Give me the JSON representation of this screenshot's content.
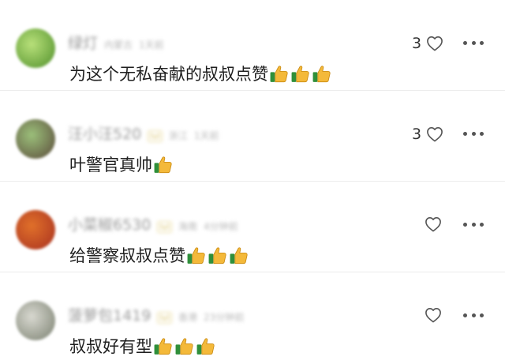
{
  "comments": [
    {
      "name": "绿灯",
      "level": "",
      "region": "内蒙古",
      "time": "1天前",
      "text": "为这个无私奋献的叔叔点赞",
      "thumbs_count": 3,
      "likes": "3",
      "avatar_colors": [
        "#4f8f2a",
        "#b8e07a"
      ]
    },
    {
      "name": "汪小汪520",
      "level": "lvl",
      "region": "浙江",
      "time": "1天前",
      "text": "叶警官真帅",
      "thumbs_count": 1,
      "likes": "3",
      "avatar_colors": [
        "#5a4a3a",
        "#9bbf7a"
      ]
    },
    {
      "name": "小菜椒6530",
      "level": "lvl",
      "region": "海南",
      "time": "4分钟前",
      "text": "给警察叔叔点赞",
      "thumbs_count": 3,
      "likes": "",
      "avatar_colors": [
        "#a83020",
        "#e0702a"
      ]
    },
    {
      "name": "菠萝包1419",
      "level": "lvl",
      "region": "香港",
      "time": "23分钟前",
      "text": "叔叔好有型",
      "thumbs_count": 3,
      "likes": "",
      "avatar_colors": [
        "#7a8070",
        "#d8d8d0"
      ]
    }
  ],
  "icons": {
    "like": "heart-outline-icon",
    "more": "more-dots-icon",
    "reaction": "thumbs-up-emoji"
  }
}
